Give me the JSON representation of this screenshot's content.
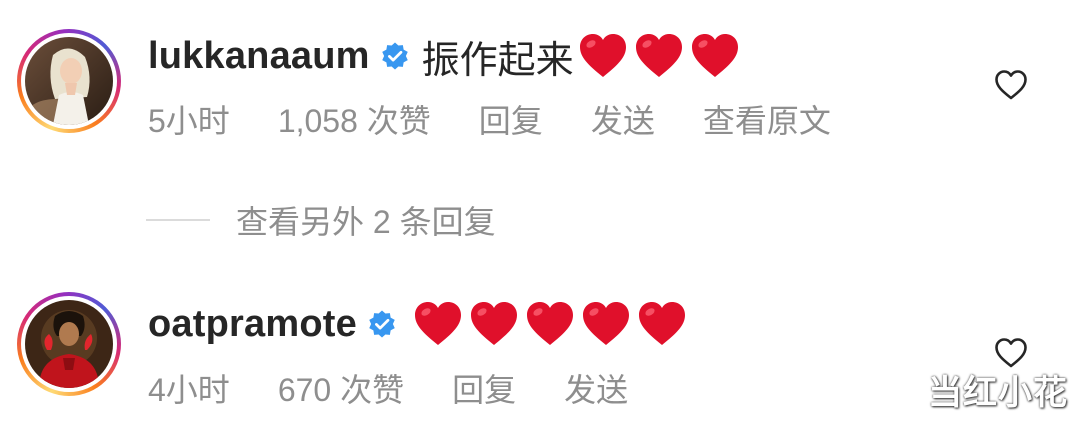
{
  "comments": [
    {
      "username": "lukkanaaum",
      "verified": true,
      "text": "振作起来",
      "emoji": "red-heart",
      "emoji_count": 3,
      "time": "5小时",
      "likes": "1,058 次赞",
      "reply": "回复",
      "send": "发送",
      "translate": "查看原文"
    },
    {
      "username": "oatpramote",
      "verified": true,
      "text": "",
      "emoji": "red-heart",
      "emoji_count": 5,
      "time": "4小时",
      "likes": "670 次赞",
      "reply": "回复",
      "send": "发送"
    }
  ],
  "view_replies": "查看另外 2 条回复",
  "watermark": "当红小花",
  "colors": {
    "text": "#262626",
    "meta": "#8e8e8e",
    "verified": "#3897f0",
    "heart": "#e0102b"
  }
}
